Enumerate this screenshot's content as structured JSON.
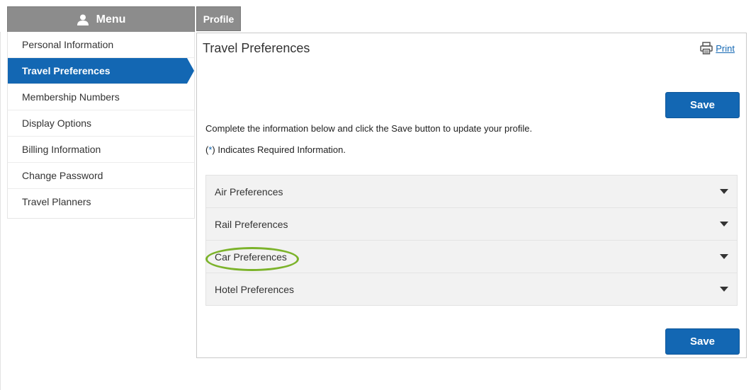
{
  "menu": {
    "header_label": "Menu",
    "items": [
      {
        "label": "Personal Information",
        "active": false
      },
      {
        "label": "Travel Preferences",
        "active": true
      },
      {
        "label": "Membership Numbers",
        "active": false
      },
      {
        "label": "Display Options",
        "active": false
      },
      {
        "label": "Billing Information",
        "active": false
      },
      {
        "label": "Change Password",
        "active": false
      },
      {
        "label": "Travel Planners",
        "active": false
      }
    ]
  },
  "tab": {
    "profile_label": "Profile"
  },
  "panel": {
    "title": "Travel Preferences",
    "print_label": "Print",
    "save_label": "Save",
    "instructions": "Complete the information below and click the Save button to update your profile.",
    "required_prefix": "(",
    "required_star": "*",
    "required_suffix": ") Indicates Required Information."
  },
  "accordion": {
    "items": [
      {
        "label": "Air Preferences"
      },
      {
        "label": "Rail Preferences"
      },
      {
        "label": "Car Preferences",
        "highlighted": true
      },
      {
        "label": "Hotel Preferences"
      }
    ]
  },
  "colors": {
    "accent": "#1367b3",
    "tab_gray": "#8c8c8c",
    "highlight": "#7cb32b"
  },
  "icons": {
    "menu_icon": "user-icon",
    "print_icon": "printer-icon",
    "caret_icon": "chevron-down-icon"
  }
}
